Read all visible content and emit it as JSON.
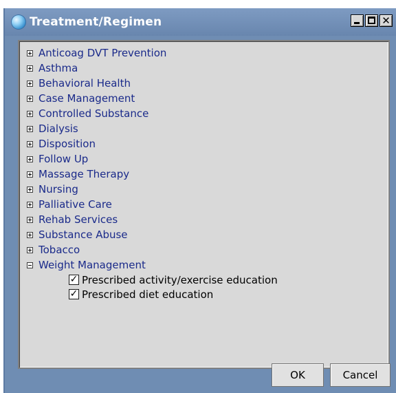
{
  "window": {
    "title": "Treatment/Regimen",
    "controls": {
      "minimize": "minimize",
      "maximize": "maximize",
      "close": "✕"
    }
  },
  "tree": {
    "items": [
      {
        "label": "Anticoag DVT Prevention",
        "expanded": false
      },
      {
        "label": "Asthma",
        "expanded": false
      },
      {
        "label": "Behavioral Health",
        "expanded": false
      },
      {
        "label": "Case Management",
        "expanded": false
      },
      {
        "label": "Controlled Substance",
        "expanded": false
      },
      {
        "label": "Dialysis",
        "expanded": false
      },
      {
        "label": "Disposition",
        "expanded": false
      },
      {
        "label": "Follow Up",
        "expanded": false
      },
      {
        "label": "Massage Therapy",
        "expanded": false
      },
      {
        "label": "Nursing",
        "expanded": false
      },
      {
        "label": "Palliative Care",
        "expanded": false
      },
      {
        "label": "Rehab Services",
        "expanded": false
      },
      {
        "label": "Substance Abuse",
        "expanded": false
      },
      {
        "label": "Tobacco",
        "expanded": false
      },
      {
        "label": "Weight Management",
        "expanded": true,
        "children": [
          {
            "label": "Prescribed activity/exercise education",
            "checked": true
          },
          {
            "label": "Prescribed diet education",
            "checked": true
          }
        ]
      }
    ]
  },
  "buttons": {
    "ok": "OK",
    "cancel": "Cancel"
  },
  "check_mark": "✓"
}
